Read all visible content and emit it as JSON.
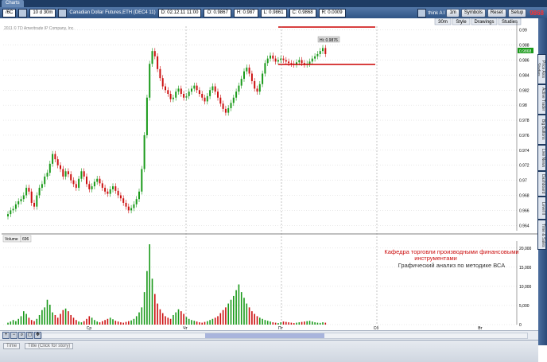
{
  "window": {
    "tab_label": "Charts"
  },
  "toolbar": {
    "symbol": "/6C",
    "interval": "10 d 30m",
    "instrument": "Canadian Dollar Futures,ETH (DEC4 11)",
    "date": "D: 02.12.11 11:00",
    "open": "O: 0.9867",
    "high": "H: 0.987",
    "low": "L: 0.9861",
    "close": "C: 0.9868",
    "range": "R: 0.0009",
    "think_label": "think A I",
    "right_price": "9868",
    "buttons": {
      "tf": "1m",
      "symbols": "Symbols",
      "reset": "Reset",
      "setup": "Setup",
      "aggregation": "30m",
      "style": "Style",
      "drawings": "Drawings",
      "studies": "Studies"
    }
  },
  "chart": {
    "copyright": "2011 © TD Ameritrade IP Company, Inc.",
    "hi_label": "Hi: 0.9876",
    "last_price_tag": "0.9868",
    "price_ticks": [
      "0.99",
      "0.988",
      "0.986",
      "0.984",
      "0.982",
      "0.98",
      "0.978",
      "0.976",
      "0.974",
      "0.972",
      "0.97",
      "0.968",
      "0.966",
      "0.964"
    ],
    "volume_label": "Volume",
    "volume_value": "696",
    "volume_ticks": [
      "20,000",
      "15,000",
      "10,000",
      "5,000",
      "0"
    ],
    "day_labels": [
      "Ср",
      "Чт",
      "Пт",
      "Сб",
      "Вт"
    ],
    "annotation_line1": "Кафедра торговли производными финансовыми",
    "annotation_line2": "инструментами",
    "annotation_line3": "Графический анализ по методике ВСА",
    "colors": {
      "up": "#1a9a1a",
      "down": "#cc1111",
      "sr_line": "#cc0000",
      "grid": "#c8c8c8"
    }
  },
  "sidebar_tabs": [
    "Price Axis Studies",
    "Active Trader",
    "Big Buttons",
    "Live News",
    "Dashboard",
    "Level II",
    "Time & Sales"
  ],
  "status": {
    "time_label": "Time",
    "title_placeholder": "Title (Click for story)"
  },
  "chart_data": [
    {
      "type": "candlestick",
      "title": "Canadian Dollar Futures,ETH (DEC4 11)",
      "ylim": [
        0.9635,
        0.9905
      ],
      "x_categories": [
        "Ср",
        "Чт",
        "Пт",
        "Сб",
        "Вт"
      ],
      "series": [
        {
          "values": [
            0.9655,
            0.966,
            0.9662,
            0.9668,
            0.9672,
            0.9675,
            0.968,
            0.969,
            0.9685,
            0.967,
            0.9665,
            0.968,
            0.969,
            0.9695,
            0.9705,
            0.971,
            0.9722,
            0.9735,
            0.9728,
            0.972,
            0.9715,
            0.9705,
            0.9712,
            0.9708,
            0.97,
            0.9695,
            0.969,
            0.9702,
            0.9712,
            0.9705,
            0.9695,
            0.9688,
            0.9692,
            0.9698,
            0.9702,
            0.9696,
            0.969,
            0.9685,
            0.9682,
            0.9688,
            0.9692,
            0.9686,
            0.968,
            0.9676,
            0.967,
            0.9665,
            0.966,
            0.9663,
            0.9668,
            0.9675,
            0.9685,
            0.9715,
            0.976,
            0.981,
            0.9855,
            0.9872,
            0.9865,
            0.9848,
            0.9836,
            0.9825,
            0.982,
            0.9815,
            0.9808,
            0.981,
            0.9818,
            0.9822,
            0.9815,
            0.981,
            0.9812,
            0.9818,
            0.9822,
            0.9826,
            0.982,
            0.9815,
            0.981,
            0.9805,
            0.9812,
            0.982,
            0.9825,
            0.9818,
            0.981,
            0.9802,
            0.9795,
            0.979,
            0.9796,
            0.9803,
            0.981,
            0.9818,
            0.9826,
            0.9835,
            0.9845,
            0.985,
            0.9842,
            0.9832,
            0.9822,
            0.9818,
            0.9828,
            0.9842,
            0.9856,
            0.9862,
            0.9866,
            0.9862,
            0.9858,
            0.986,
            0.9862,
            0.986,
            0.9858,
            0.9856,
            0.9855,
            0.9854,
            0.9857,
            0.986,
            0.9856,
            0.9854,
            0.9855,
            0.9858,
            0.9862,
            0.9865,
            0.9868,
            0.9872,
            0.9876,
            0.9868
          ]
        }
      ]
    },
    {
      "type": "bar",
      "title": "Volume",
      "ylim": [
        0,
        21000
      ],
      "series": [
        {
          "values": [
            500,
            800,
            1200,
            900,
            1500,
            2200,
            3500,
            2800,
            1800,
            1200,
            900,
            1500,
            2500,
            3800,
            4500,
            6500,
            5200,
            3200,
            2500,
            1800,
            2800,
            3800,
            4200,
            3500,
            2500,
            1800,
            1200,
            800,
            600,
            900,
            1500,
            2200,
            1800,
            1200,
            800,
            600,
            900,
            1200,
            1500,
            1800,
            1400,
            1000,
            800,
            600,
            500,
            700,
            900,
            1100,
            1500,
            2200,
            3200,
            4500,
            8500,
            14000,
            21000,
            12000,
            8000,
            5500,
            4000,
            3000,
            2200,
            1800,
            1500,
            2500,
            3200,
            4000,
            3500,
            2800,
            2000,
            1500,
            1200,
            1000,
            800,
            600,
            500,
            700,
            900,
            1200,
            1500,
            1800,
            2200,
            3000,
            3800,
            4500,
            5500,
            6500,
            7500,
            9000,
            10500,
            8500,
            7000,
            5500,
            4500,
            3500,
            2800,
            2200,
            1800,
            1500,
            1200,
            1000,
            800,
            600,
            500,
            400,
            600,
            800,
            700,
            600,
            500,
            400,
            500,
            600,
            700,
            800,
            900,
            1000,
            800,
            600,
            500,
            450,
            600,
            500
          ]
        }
      ]
    }
  ]
}
